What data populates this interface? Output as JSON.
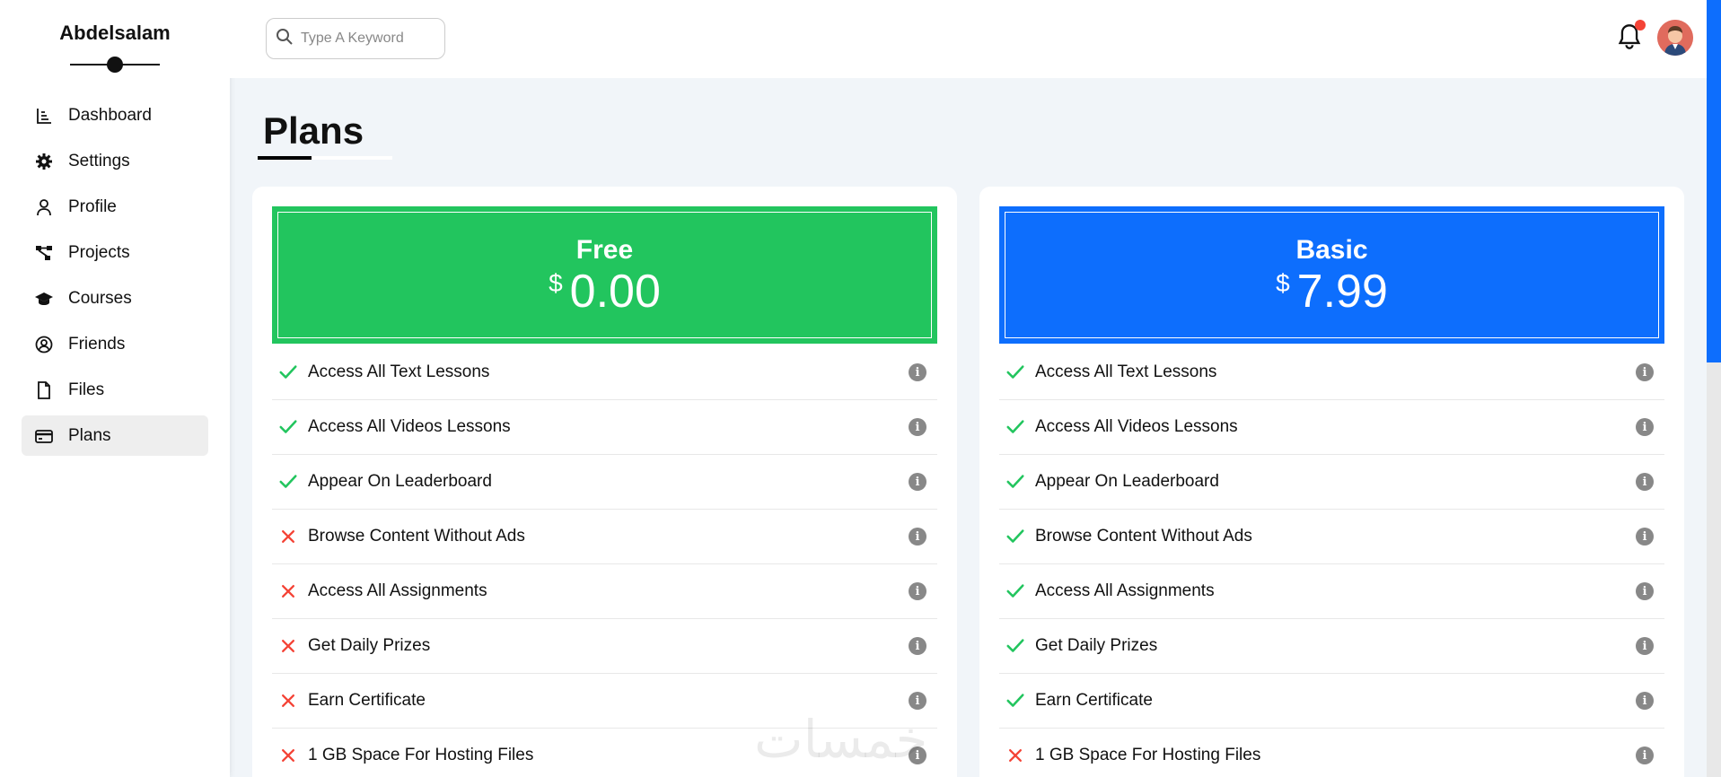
{
  "sidebar": {
    "brand": "Abdelsalam",
    "items": [
      {
        "label": "Dashboard",
        "icon": "chart-icon",
        "active": false
      },
      {
        "label": "Settings",
        "icon": "gear-icon",
        "active": false
      },
      {
        "label": "Profile",
        "icon": "user-icon",
        "active": false
      },
      {
        "label": "Projects",
        "icon": "diagram-icon",
        "active": false
      },
      {
        "label": "Courses",
        "icon": "graduation-cap-icon",
        "active": false
      },
      {
        "label": "Friends",
        "icon": "user-circle-icon",
        "active": false
      },
      {
        "label": "Files",
        "icon": "file-icon",
        "active": false
      },
      {
        "label": "Plans",
        "icon": "credit-card-icon",
        "active": true
      }
    ]
  },
  "header": {
    "search": {
      "placeholder": "Type A Keyword",
      "icon": "search-icon"
    },
    "notification_icon": "bell-icon",
    "avatar_icon": "avatar"
  },
  "main": {
    "title": "Plans",
    "plans": [
      {
        "name": "Free",
        "currency": "$",
        "price": "0.00",
        "color": "#22c55e",
        "features": [
          {
            "label": "Access All Text Lessons",
            "included": true
          },
          {
            "label": "Access All Videos Lessons",
            "included": true
          },
          {
            "label": "Appear On Leaderboard",
            "included": true
          },
          {
            "label": "Browse Content Without Ads",
            "included": false
          },
          {
            "label": "Access All Assignments",
            "included": false
          },
          {
            "label": "Get Daily Prizes",
            "included": false
          },
          {
            "label": "Earn Certificate",
            "included": false
          },
          {
            "label": "1 GB Space For Hosting Files",
            "included": false
          }
        ]
      },
      {
        "name": "Basic",
        "currency": "$",
        "price": "7.99",
        "color": "#0d6efd",
        "features": [
          {
            "label": "Access All Text Lessons",
            "included": true
          },
          {
            "label": "Access All Videos Lessons",
            "included": true
          },
          {
            "label": "Appear On Leaderboard",
            "included": true
          },
          {
            "label": "Browse Content Without Ads",
            "included": true
          },
          {
            "label": "Access All Assignments",
            "included": true
          },
          {
            "label": "Get Daily Prizes",
            "included": true
          },
          {
            "label": "Earn Certificate",
            "included": true
          },
          {
            "label": "1 GB Space For Hosting Files",
            "included": false
          }
        ]
      }
    ]
  },
  "watermark": "خمسات",
  "colors": {
    "check": "#22c55e",
    "cross": "#f44336",
    "info": "#888888",
    "accent": "#0d6efd"
  }
}
